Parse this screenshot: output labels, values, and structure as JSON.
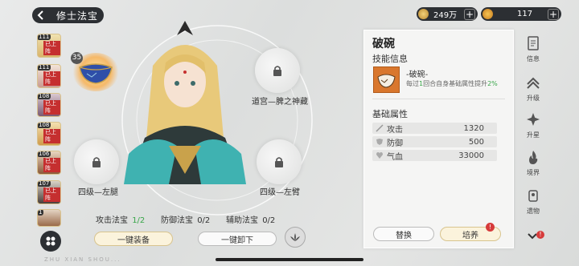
{
  "header": {
    "title": "修士法宝",
    "coins": "249万",
    "gems": "117"
  },
  "avatars": [
    {
      "level": "111",
      "tag": "已上阵"
    },
    {
      "level": "111",
      "tag": "已上阵"
    },
    {
      "level": "108",
      "tag": "已上阵"
    },
    {
      "level": "108",
      "tag": "已上阵"
    },
    {
      "level": "106",
      "tag": "已上阵"
    },
    {
      "level": "107",
      "tag": "已上阵"
    },
    {
      "level": "1",
      "tag": ""
    }
  ],
  "equipped_bowl_level": "35",
  "slots": {
    "right_top": "道宫—脾之神藏",
    "left": "四级—左腿",
    "right": "四级—左臂"
  },
  "counts": [
    {
      "label": "攻击法宝",
      "value": "1/2"
    },
    {
      "label": "防御法宝",
      "value": "0/2"
    },
    {
      "label": "辅助法宝",
      "value": "0/2"
    }
  ],
  "buttons": {
    "equip_all": "一键装备",
    "unequip_all": "一键卸下"
  },
  "watermark": "ZHU XIAN SHOU...",
  "panel": {
    "name": "破碗",
    "skill_header": "技能信息",
    "skill_name": "-破碗-",
    "skill_desc_1": "每过",
    "skill_num": "1",
    "skill_desc_2": "回合自身基础属性提升",
    "skill_pct": "2%",
    "base_header": "基础属性",
    "stats": [
      {
        "name": "攻击",
        "value": "1320"
      },
      {
        "name": "防御",
        "value": "500"
      },
      {
        "name": "气血",
        "value": "33000"
      }
    ],
    "replace": "替换",
    "cultivate": "培养"
  },
  "nav": [
    {
      "label": "信息"
    },
    {
      "label": "升级"
    },
    {
      "label": "升星"
    },
    {
      "label": "境界"
    },
    {
      "label": "遗物"
    }
  ],
  "colors": {
    "green": "#3aa64a",
    "accent_gold": "#c9a24b",
    "dark": "#2c2f33",
    "red": "#d63b3b"
  }
}
